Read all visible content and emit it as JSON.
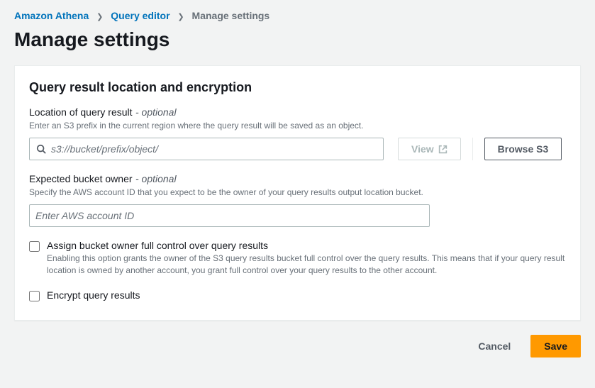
{
  "breadcrumbs": {
    "items": [
      {
        "label": "Amazon Athena"
      },
      {
        "label": "Query editor"
      }
    ],
    "current": "Manage settings"
  },
  "page_title": "Manage settings",
  "card": {
    "section_title": "Query result location and encryption",
    "location": {
      "label": "Location of query result",
      "optional": "- optional",
      "hint": "Enter an S3 prefix in the current region where the query result will be saved as an object.",
      "placeholder": "s3://bucket/prefix/object/",
      "value": ""
    },
    "view_button": "View",
    "browse_button": "Browse S3",
    "owner": {
      "label": "Expected bucket owner",
      "optional": "- optional",
      "hint": "Specify the AWS account ID that you expect to be the owner of your query results output location bucket.",
      "placeholder": "Enter AWS account ID",
      "value": ""
    },
    "assign": {
      "label": "Assign bucket owner full control over query results",
      "desc": "Enabling this option grants the owner of the S3 query results bucket full control over the query results. This means that if your query result location is owned by another account, you grant full control over your query results to the other account."
    },
    "encrypt": {
      "label": "Encrypt query results"
    }
  },
  "footer": {
    "cancel": "Cancel",
    "save": "Save"
  }
}
